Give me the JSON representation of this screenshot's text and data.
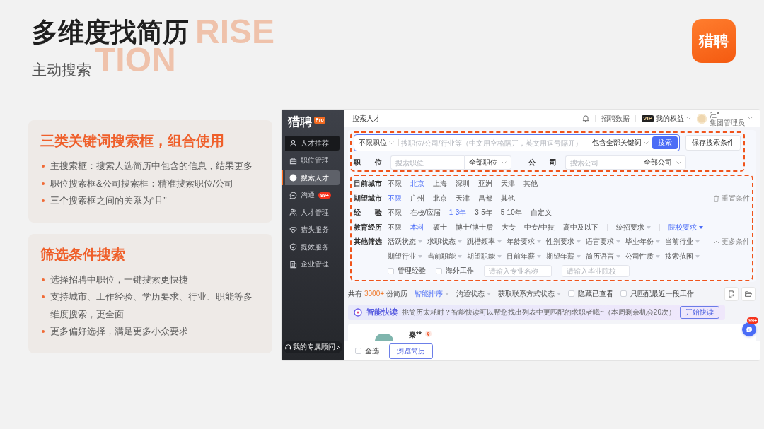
{
  "slide": {
    "title": "多维度找简历",
    "subtitle": "主动搜索",
    "decor_text": [
      "RISE",
      "TION"
    ]
  },
  "logo": {
    "text": "猎聘"
  },
  "feature_cards": [
    {
      "title": "三类关键词搜索框，组合使用",
      "bullets": [
        "主搜索框：搜索人选简历中包含的信息，结果更多",
        "职位搜索框&公司搜索框：精准搜索职位/公司",
        "三个搜索框之间的关系为“且”"
      ]
    },
    {
      "title": "筛选条件搜索",
      "bullets": [
        "选择招聘中职位，一键搜索更快捷",
        "支持城市、工作经验、学历要求、行业、职能等多维度搜索，更全面",
        "更多偏好选择，满足更多小众要求"
      ]
    }
  ],
  "app": {
    "sidebar": {
      "logo": "猎聘",
      "logo_badge": "Pro",
      "items": [
        {
          "label": "人才推荐",
          "selected": false,
          "hovered": true
        },
        {
          "label": "职位管理",
          "selected": false,
          "hovered": false
        },
        {
          "label": "搜索人才",
          "selected": true,
          "hovered": false
        },
        {
          "label": "沟通",
          "badge": "99+",
          "selected": false,
          "hovered": false
        },
        {
          "label": "人才管理",
          "selected": false,
          "hovered": false
        },
        {
          "label": "猎头服务",
          "selected": false,
          "hovered": false
        },
        {
          "label": "提效服务",
          "selected": false,
          "hovered": false
        },
        {
          "label": "企业管理",
          "selected": false,
          "hovered": false
        }
      ],
      "advisor": "我的专属顾问"
    },
    "top_bar": {
      "title": "搜索人才",
      "links": [
        "招聘数据"
      ],
      "vip_badge": "VIP",
      "benefits": "我的权益",
      "user": {
        "name": "汪*",
        "role": "集团管理员"
      }
    },
    "search": {
      "scope": "不限职位",
      "placeholder": "搜职位/公司/行业等（中文用空格隔开，英文用逗号隔开）",
      "match_mode": "包含全部关键词",
      "button": "搜索",
      "save_button": "保存搜索条件",
      "fields": [
        {
          "label": "职 位",
          "placeholder": "搜索职位",
          "dropdown": "全部职位"
        },
        {
          "label": "公 司",
          "placeholder": "搜索公司",
          "dropdown": "全部公司"
        }
      ]
    },
    "filters": [
      {
        "label": "目前城市",
        "options": [
          {
            "kind": "option",
            "text": "不限",
            "selected": false
          },
          {
            "kind": "option",
            "text": "北京",
            "selected": true
          },
          {
            "kind": "option",
            "text": "上海",
            "selected": false
          },
          {
            "kind": "option",
            "text": "深圳",
            "selected": false
          },
          {
            "kind": "option",
            "text": "亚洲",
            "selected": false
          },
          {
            "kind": "option",
            "text": "天津",
            "selected": false
          },
          {
            "kind": "option",
            "text": "其他",
            "selected": false
          }
        ]
      },
      {
        "label": "期望城市",
        "options": [
          {
            "kind": "option",
            "text": "不限",
            "selected": true
          },
          {
            "kind": "option",
            "text": "广州",
            "selected": false
          },
          {
            "kind": "option",
            "text": "北京",
            "selected": false
          },
          {
            "kind": "option",
            "text": "天津",
            "selected": false
          },
          {
            "kind": "option",
            "text": "昌都",
            "selected": false
          },
          {
            "kind": "option",
            "text": "其他",
            "selected": false
          }
        ],
        "action": {
          "kind": "reset",
          "text": "重置条件"
        }
      },
      {
        "label": "经 验",
        "options": [
          {
            "kind": "option",
            "text": "不限",
            "selected": false
          },
          {
            "kind": "option",
            "text": "在校/应届",
            "selected": false
          },
          {
            "kind": "option",
            "text": "1-3年",
            "selected": true
          },
          {
            "kind": "option",
            "text": "3-5年",
            "selected": false
          },
          {
            "kind": "option",
            "text": "5-10年",
            "selected": false
          },
          {
            "kind": "option",
            "text": "自定义",
            "selected": false
          }
        ]
      },
      {
        "label": "教育经历",
        "options": [
          {
            "kind": "option",
            "text": "不限",
            "selected": false
          },
          {
            "kind": "option",
            "text": "本科",
            "selected": true
          },
          {
            "kind": "option",
            "text": "硕士",
            "selected": false
          },
          {
            "kind": "option",
            "text": "博士/博士后",
            "selected": false
          },
          {
            "kind": "option",
            "text": "大专",
            "selected": false
          },
          {
            "kind": "option",
            "text": "中专/中技",
            "selected": false
          },
          {
            "kind": "option",
            "text": "高中及以下",
            "selected": false
          },
          {
            "kind": "dropdown",
            "text": "统招要求",
            "selected": false
          },
          {
            "kind": "dropdown",
            "text": "院校要求",
            "selected": true
          }
        ]
      }
    ],
    "other_filters": {
      "label": "其他筛选",
      "dropdown_rows": [
        [
          "活跃状态",
          "求职状态",
          "跳槽频率",
          "年龄要求",
          "性别要求",
          "语言要求",
          "毕业年份",
          "当前行业"
        ],
        [
          "期望行业",
          "当前职能",
          "期望职能",
          "目前年薪",
          "期望年薪",
          "简历语言",
          "公司性质",
          "搜索范围"
        ]
      ],
      "checkboxes": [
        {
          "label": "管理经验",
          "checked": false
        },
        {
          "label": "海外工作",
          "checked": false
        }
      ],
      "inputs": [
        {
          "placeholder": "请输入专业名称"
        },
        {
          "placeholder": "请输入毕业院校"
        }
      ],
      "action": {
        "kind": "collapse",
        "text": "更多条件"
      }
    },
    "results_bar": {
      "count_prefix": "共有",
      "count": "3000+",
      "count_suffix": "份简历",
      "sorts": [
        {
          "text": "智能排序",
          "selected": true
        },
        {
          "text": "沟通状态",
          "selected": false
        },
        {
          "text": "获取联系方式状态",
          "selected": false
        }
      ],
      "checkboxes": [
        {
          "label": "隐藏已查看",
          "checked": false
        },
        {
          "label": "只匹配最近一段工作",
          "checked": false
        }
      ]
    },
    "quick_read": {
      "title": "智能快读",
      "text": "挑简历太耗时？智能快读可以帮您找出列表中更匹配的求职者哦~（本周剩余机会20次）",
      "button": "开始快读"
    },
    "candidate": {
      "name": "秦**"
    },
    "footer": {
      "select_all": {
        "label": "全选",
        "checked": false
      },
      "button": "浏览简历"
    },
    "chat_badge": "99+"
  }
}
